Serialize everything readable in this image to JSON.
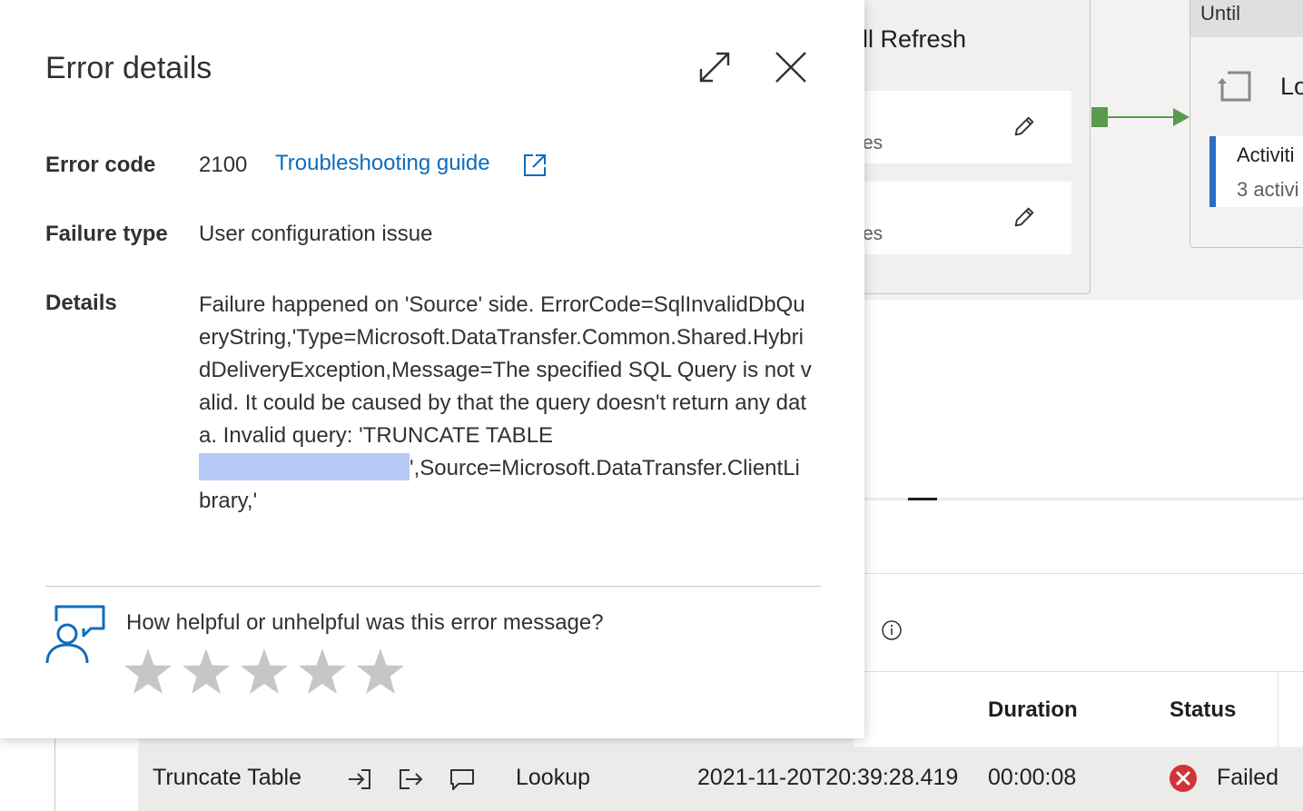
{
  "background": {
    "group_title": "ull Refresh",
    "sub_cards": [
      {
        "text": "es"
      },
      {
        "text": "es"
      }
    ],
    "until_box": {
      "label": "Until",
      "activity_name_partial": "Lo",
      "activities_title": "Activiti",
      "activities_count": "3 activi"
    },
    "table": {
      "columns": [
        "Duration",
        "Status"
      ],
      "row": {
        "activity_name": "Truncate Table",
        "activity_type": "Lookup",
        "run_start": "2021-11-20T20:39:28.419",
        "duration": "00:00:08",
        "status": "Failed"
      }
    }
  },
  "panel": {
    "title": "Error details",
    "error_code_label": "Error code",
    "error_code": "2100",
    "troubleshooting_link": "Troubleshooting guide",
    "failure_type_label": "Failure type",
    "failure_type": "User configuration issue",
    "details_label": "Details",
    "details_before": "Failure happened on 'Source' side. ErrorCode=SqlInvalidDbQueryString,'Type=Microsoft.DataTransfer.Common.Shared.HybridDeliveryException,Message=The specified SQL Query is not valid. It could be caused by that the query doesn't return any data. Invalid query: 'TRUNCATE TABLE\n",
    "details_after": "',Source=Microsoft.DataTransfer.ClientLibrary,'",
    "feedback_question": "How helpful or unhelpful was this error message?",
    "rating_stars": 5,
    "rating_value": 0
  },
  "colors": {
    "link": "#0f6cbd",
    "success_connector": "#5a9a4d",
    "fail_red": "#d13438",
    "star_empty": "#c8c6c4",
    "redaction": "#b4c9f5"
  },
  "icons": {
    "expand": "expand-icon",
    "close": "close-icon",
    "external_link": "external-link-icon",
    "feedback": "feedback-icon",
    "star": "star-icon",
    "edit": "pencil-icon",
    "info": "info-icon",
    "input": "input-icon",
    "output": "output-icon",
    "comment": "comment-icon",
    "error": "error-circle-icon"
  }
}
